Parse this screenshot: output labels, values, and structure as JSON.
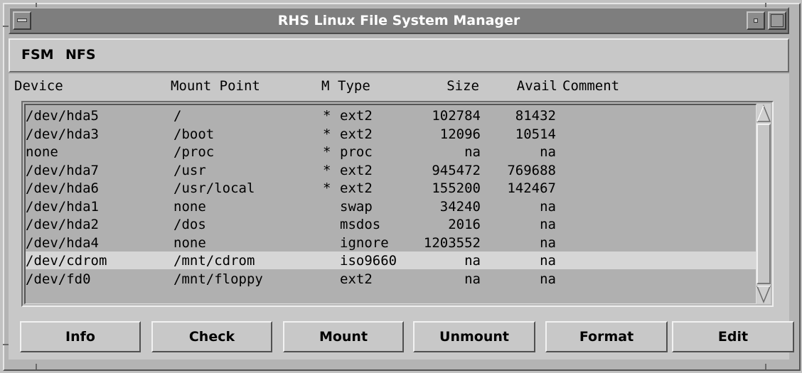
{
  "window": {
    "title": "RHS Linux File System Manager"
  },
  "menubar": {
    "items": [
      {
        "label": "FSM"
      },
      {
        "label": "NFS"
      }
    ]
  },
  "table": {
    "columns": {
      "device": "Device",
      "mount_point": "Mount Point",
      "mounted": "M",
      "type": "Type",
      "size": "Size",
      "avail": "Avail",
      "comment": "Comment"
    },
    "rows": [
      {
        "device": "/dev/hda5",
        "mount_point": "/",
        "mounted": "*",
        "type": "ext2",
        "size": "102784",
        "avail": "81432",
        "comment": ""
      },
      {
        "device": "/dev/hda3",
        "mount_point": "/boot",
        "mounted": "*",
        "type": "ext2",
        "size": "12096",
        "avail": "10514",
        "comment": ""
      },
      {
        "device": "none",
        "mount_point": "/proc",
        "mounted": "*",
        "type": "proc",
        "size": "na",
        "avail": "na",
        "comment": ""
      },
      {
        "device": "/dev/hda7",
        "mount_point": "/usr",
        "mounted": "*",
        "type": "ext2",
        "size": "945472",
        "avail": "769688",
        "comment": ""
      },
      {
        "device": "/dev/hda6",
        "mount_point": "/usr/local",
        "mounted": "*",
        "type": "ext2",
        "size": "155200",
        "avail": "142467",
        "comment": ""
      },
      {
        "device": "/dev/hda1",
        "mount_point": "none",
        "mounted": "",
        "type": "swap",
        "size": "34240",
        "avail": "na",
        "comment": ""
      },
      {
        "device": "/dev/hda2",
        "mount_point": "/dos",
        "mounted": "",
        "type": "msdos",
        "size": "2016",
        "avail": "na",
        "comment": ""
      },
      {
        "device": "/dev/hda4",
        "mount_point": "none",
        "mounted": "",
        "type": "ignore",
        "size": "1203552",
        "avail": "na",
        "comment": ""
      },
      {
        "device": "/dev/cdrom",
        "mount_point": "/mnt/cdrom",
        "mounted": "",
        "type": "iso9660",
        "size": "na",
        "avail": "na",
        "comment": "",
        "selected": true
      },
      {
        "device": "/dev/fd0",
        "mount_point": "/mnt/floppy",
        "mounted": "",
        "type": "ext2",
        "size": "na",
        "avail": "na",
        "comment": ""
      }
    ]
  },
  "buttons": {
    "info": "Info",
    "check": "Check",
    "mount": "Mount",
    "unmount": "Unmount",
    "format": "Format",
    "edit": "Edit"
  },
  "icons": {
    "window_menu": "window-menu-icon",
    "minimize": "minimize-icon",
    "maximize": "maximize-icon",
    "scroll_up": "scroll-up-arrow-icon",
    "scroll_down": "scroll-down-arrow-icon"
  },
  "colors": {
    "titlebar": "#7e7e7e",
    "window_bg": "#c8c8c8",
    "list_bg": "#b0b0b0",
    "selected_row": "#d6d6d6"
  }
}
